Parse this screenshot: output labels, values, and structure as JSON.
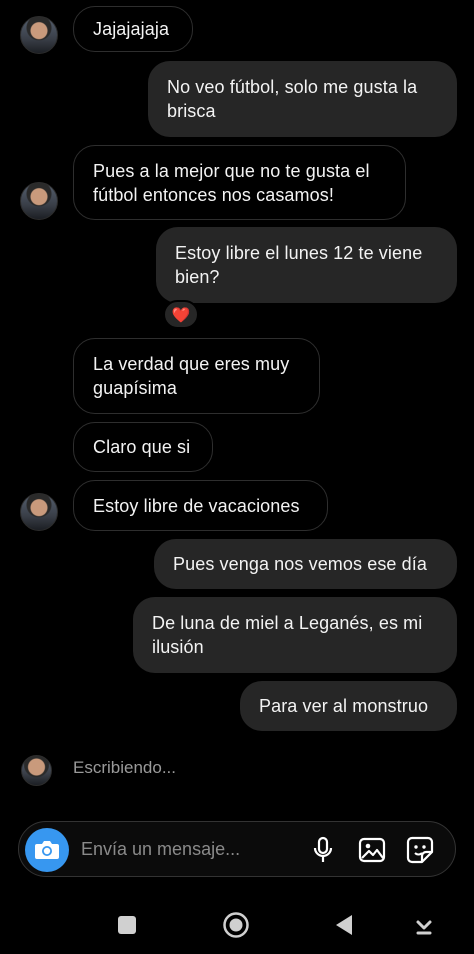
{
  "messages": [
    {
      "text": "Jajajajaja"
    },
    {
      "text": "No veo fútbol, solo me gusta la brisca"
    },
    {
      "text": "Pues a la mejor que no te gusta el fútbol entonces nos casamos!"
    },
    {
      "text": "Estoy libre el lunes 12 te viene bien?"
    },
    {
      "text": "La verdad que eres muy guapísima"
    },
    {
      "text": "Claro que si"
    },
    {
      "text": "Estoy libre de vacaciones"
    },
    {
      "text": "Pues venga nos vemos ese día"
    },
    {
      "text": "De luna de miel a Leganés, es mi ilusión"
    },
    {
      "text": "Para ver al monstruo"
    }
  ],
  "reaction": {
    "emoji": "❤️"
  },
  "typing": {
    "text": "Escribiendo..."
  },
  "composer": {
    "placeholder": "Envía un mensaje..."
  },
  "colors": {
    "background": "#000000",
    "outgoing_bubble": "#262626",
    "incoming_border": "#2e2e2e",
    "camera_button": "#3797f0",
    "heart": "#ed2f44"
  },
  "icons": {
    "camera": "camera-icon",
    "mic": "microphone-icon",
    "gallery": "gallery-icon",
    "sticker": "sticker-icon",
    "nav_recents": "square-recents-icon",
    "nav_home": "circle-home-icon",
    "nav_back": "triangle-back-icon",
    "nav_extra": "down-arrow-icon"
  }
}
